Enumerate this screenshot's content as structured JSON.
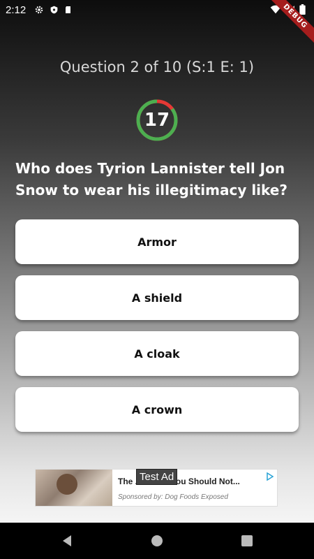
{
  "status_bar": {
    "time": "2:12",
    "left_icons": [
      "gear-icon",
      "shield-icon",
      "sd-card-icon"
    ],
    "right_icons": [
      "wifi-icon",
      "signal-icon",
      "battery-icon"
    ]
  },
  "debug_banner": "DEBUG",
  "quiz": {
    "counter": "Question 2 of 10 (S:1 E: 1)",
    "timer_value": "17",
    "timer_remaining_fraction": 0.85,
    "question": "Who does Tyrion Lannister tell Jon Snow to wear his illegitimacy like?",
    "answers": [
      "Armor",
      "A shield",
      "A cloak",
      "A crown"
    ]
  },
  "ad": {
    "label": "Test Ad",
    "title": "The ... Brand You Should Not...",
    "sponsor": "Sponsored by: Dog Foods Exposed"
  },
  "colors": {
    "timer_ring_green": "#4caf50",
    "timer_ring_red": "#e53935",
    "debug_red": "#a51d1d"
  }
}
